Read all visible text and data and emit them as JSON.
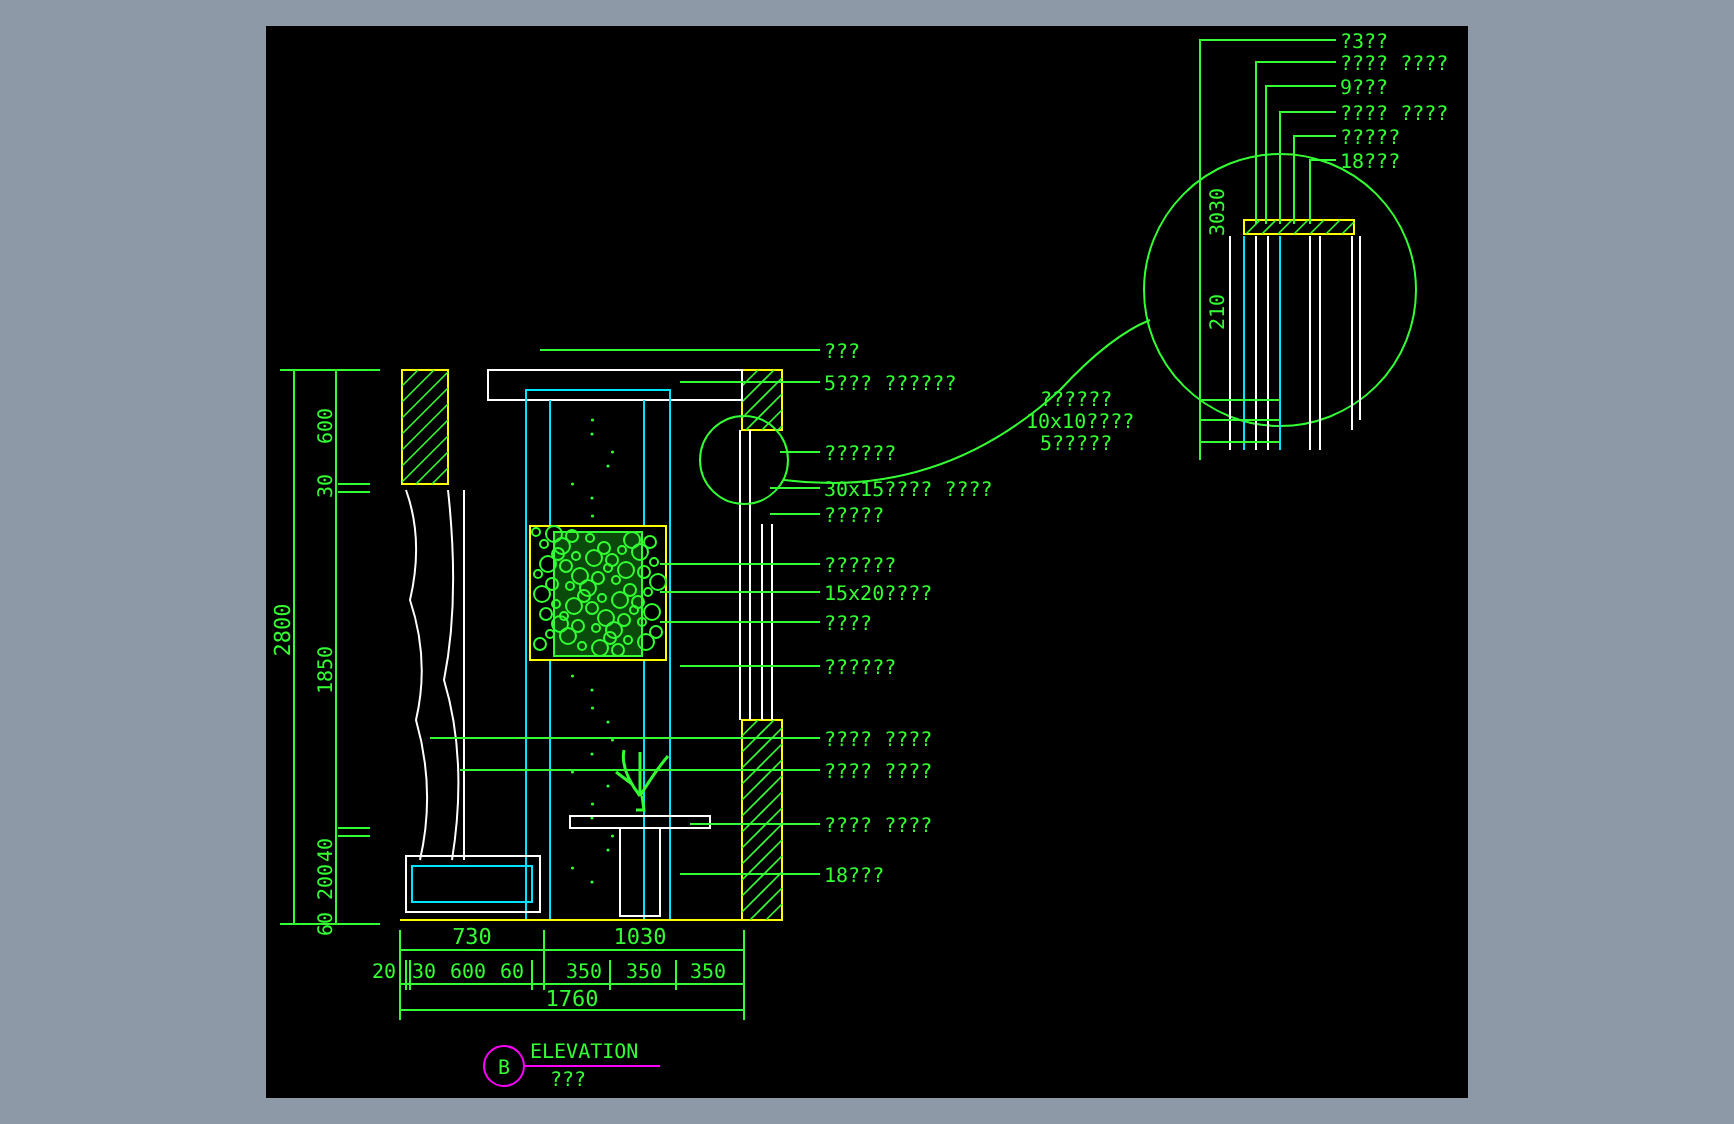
{
  "drawing": {
    "callouts": [
      {
        "text": "???"
      },
      {
        "text": "5???  ??????"
      },
      {
        "text": "??????"
      },
      {
        "text": "30x15????  ????"
      },
      {
        "text": "?????"
      },
      {
        "text": "??????"
      },
      {
        "text": "15x20????"
      },
      {
        "text": "????"
      },
      {
        "text": "??????"
      },
      {
        "text": "????   ????"
      },
      {
        "text": "????   ????"
      },
      {
        "text": "????   ????"
      },
      {
        "text": "18???"
      }
    ],
    "detail_callouts": [
      {
        "text": "?3??"
      },
      {
        "text": "????   ????"
      },
      {
        "text": "9???"
      },
      {
        "text": "????   ????"
      },
      {
        "text": "?????"
      },
      {
        "text": "18???"
      }
    ],
    "detail_side_labels": [
      "??????",
      "10x10????",
      "5?????"
    ],
    "detail_dimensions": [
      "3030",
      "210"
    ],
    "vertical_dimensions": [
      "2800",
      "600",
      "30",
      "1850",
      "40",
      "200",
      "60"
    ],
    "horizontal_dimensions": {
      "row_1": [
        "730",
        "1030"
      ],
      "row_2": [
        "20",
        "30",
        "600",
        "60",
        "350",
        "350",
        "350"
      ],
      "total": "1760"
    },
    "title": {
      "marker": "B",
      "name": "ELEVATION",
      "subtitle": "???"
    }
  }
}
